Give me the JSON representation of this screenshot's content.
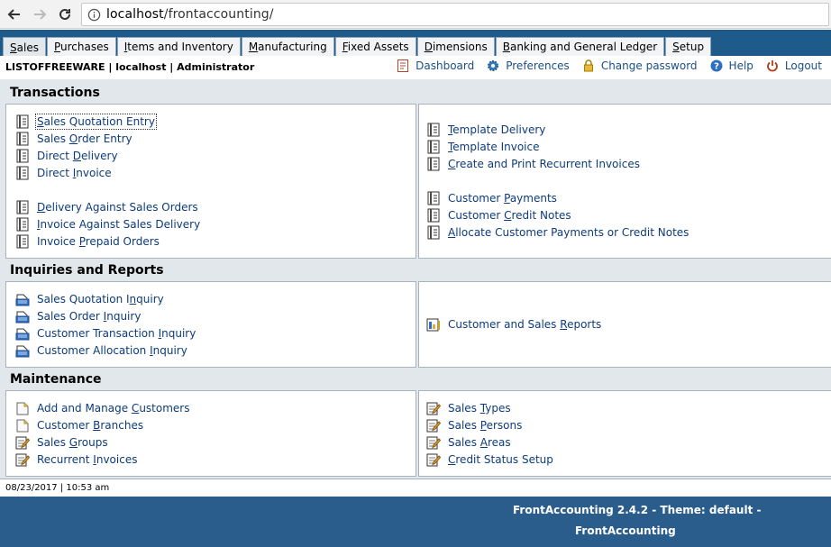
{
  "browser": {
    "url_host": "localhost",
    "url_path": "/frontaccounting/"
  },
  "tabs": [
    {
      "pre": "",
      "u": "S",
      "post": "ales"
    },
    {
      "pre": "",
      "u": "P",
      "post": "urchases"
    },
    {
      "pre": "",
      "u": "I",
      "post": "tems and Inventory"
    },
    {
      "pre": "",
      "u": "M",
      "post": "anufacturing"
    },
    {
      "pre": "",
      "u": "F",
      "post": "ixed Assets"
    },
    {
      "pre": "",
      "u": "D",
      "post": "imensions"
    },
    {
      "pre": "",
      "u": "B",
      "post": "anking and General Ledger"
    },
    {
      "pre": "",
      "u": "S",
      "post": "etup"
    }
  ],
  "user": {
    "info": "LISTOFFREEWARE | localhost | Administrator",
    "links": {
      "dashboard": "Dashboard",
      "preferences": "Preferences",
      "change_password": "Change password",
      "help": "Help",
      "logout": "Logout"
    }
  },
  "sections": {
    "transactions": {
      "title": "Transactions",
      "left": [
        {
          "pre": "",
          "u": "S",
          "post": "ales Quotation Entry"
        },
        {
          "pre": "Sales ",
          "u": "O",
          "post": "rder Entry"
        },
        {
          "pre": "Direct ",
          "u": "D",
          "post": "elivery"
        },
        {
          "pre": "Direct ",
          "u": "I",
          "post": "nvoice"
        },
        {
          "pre": "",
          "u": "D",
          "post": "elivery Against Sales Orders"
        },
        {
          "pre": "",
          "u": "I",
          "post": "nvoice Against Sales Delivery"
        },
        {
          "pre": "Invoice ",
          "u": "P",
          "post": "repaid Orders"
        }
      ],
      "right": [
        {
          "pre": "",
          "u": "T",
          "post": "emplate Delivery"
        },
        {
          "pre": "",
          "u": "T",
          "post": "emplate Invoice"
        },
        {
          "pre": "",
          "u": "C",
          "post": "reate and Print Recurrent Invoices"
        },
        {
          "pre": "Customer ",
          "u": "P",
          "post": "ayments"
        },
        {
          "pre": "Customer ",
          "u": "C",
          "post": "redit Notes"
        },
        {
          "pre": "",
          "u": "A",
          "post": "llocate Customer Payments or Credit Notes"
        }
      ]
    },
    "inquiries": {
      "title": "Inquiries and Reports",
      "left": [
        {
          "pre": "Sales Quotation I",
          "u": "n",
          "post": "quiry"
        },
        {
          "pre": "Sales Order ",
          "u": "I",
          "post": "nquiry"
        },
        {
          "pre": "Customer Transaction ",
          "u": "I",
          "post": "nquiry"
        },
        {
          "pre": "Customer Allocation ",
          "u": "I",
          "post": "nquiry"
        }
      ],
      "right": [
        {
          "pre": "Customer and Sales ",
          "u": "R",
          "post": "eports"
        }
      ]
    },
    "maintenance": {
      "title": "Maintenance",
      "left": [
        {
          "pre": "Add and Manage ",
          "u": "C",
          "post": "ustomers"
        },
        {
          "pre": "Customer ",
          "u": "B",
          "post": "ranches"
        },
        {
          "pre": "Sales ",
          "u": "G",
          "post": "roups"
        },
        {
          "pre": "Recurrent ",
          "u": "I",
          "post": "nvoices"
        }
      ],
      "right": [
        {
          "pre": "Sales ",
          "u": "T",
          "post": "ypes"
        },
        {
          "pre": "Sales ",
          "u": "P",
          "post": "ersons"
        },
        {
          "pre": "Sales ",
          "u": "A",
          "post": "reas"
        },
        {
          "pre": "",
          "u": "C",
          "post": "redit Status Setup"
        }
      ]
    }
  },
  "status": {
    "datetime": "08/23/2017 | 10:53 am"
  },
  "footer": {
    "version": "FrontAccounting 2.4.2 - Theme: default -",
    "brand": "FrontAccounting"
  },
  "colors": {
    "tab_bar": "#1f5b8a",
    "footer": "#2b5d8c",
    "page_bg": "#e2e7ec",
    "link": "#0d3b7a"
  }
}
